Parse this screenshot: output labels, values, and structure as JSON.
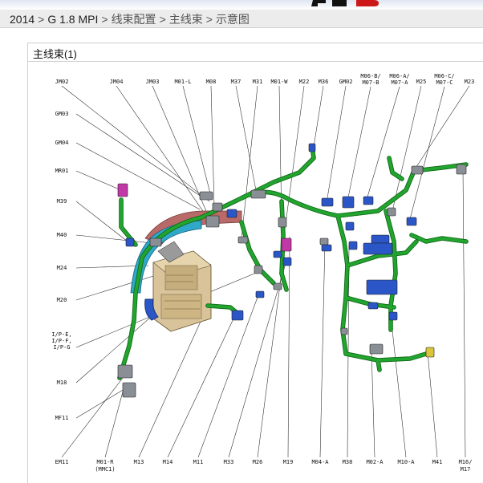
{
  "breadcrumb": [
    "2014",
    "G 1.8 MPI",
    "线束配置",
    "主线束",
    "示意图"
  ],
  "panel": {
    "title": "主线束(1)"
  },
  "labels": {
    "top": [
      "JM02",
      "JM04",
      "JM03",
      "M01-L",
      "M08",
      "M37",
      "M31",
      "M01-W",
      "M22",
      "M36",
      "GM02",
      "M06-B/",
      "M07-B",
      "M06-A/",
      "M07-A",
      "M25",
      "M06-C/",
      "M07-C",
      "M23"
    ],
    "left": [
      "GM03",
      "GM04",
      "MR01",
      "M39",
      "M40",
      "M24",
      "M20",
      "I/P-E,",
      "I/P-F,",
      "I/P-G",
      "M18",
      "MF11"
    ],
    "bottom": [
      "EM11",
      "M01-R",
      "(MMC1)",
      "M13",
      "M14",
      "M11",
      "M33",
      "M26",
      "M19",
      "M04-A",
      "M38",
      "M02-A",
      "M10-A",
      "M41",
      "M16/",
      "M17"
    ]
  },
  "colors": {
    "harness": "#22a52f",
    "harness_edge": "#106a18",
    "duct": "#2fa8c9",
    "fusebox": "#d8c39a",
    "reinforcement": "#b96a68",
    "connector_blue": "#2a56c8",
    "connector_magenta": "#c238a8",
    "connector_gray": "#8a8f96",
    "connector_yellow": "#d9c43a",
    "logo_red": "#cc1818"
  }
}
